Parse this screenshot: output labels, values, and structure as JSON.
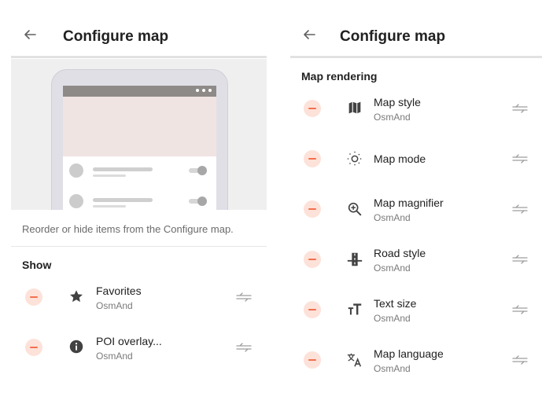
{
  "left": {
    "title": "Configure map",
    "description": "Reorder or hide items from the Configure map.",
    "section": "Show",
    "items": [
      {
        "label": "Favorites",
        "sub": "OsmAnd",
        "icon": "star-icon"
      },
      {
        "label": "POI overlay...",
        "sub": "OsmAnd",
        "icon": "info-icon"
      }
    ]
  },
  "right": {
    "title": "Configure map",
    "section": "Map rendering",
    "items": [
      {
        "label": "Map style",
        "sub": "OsmAnd",
        "icon": "map-icon"
      },
      {
        "label": "Map mode",
        "sub": "",
        "icon": "sun-icon"
      },
      {
        "label": "Map magnifier",
        "sub": "OsmAnd",
        "icon": "zoom-in-icon"
      },
      {
        "label": "Road style",
        "sub": "OsmAnd",
        "icon": "road-icon"
      },
      {
        "label": "Text size",
        "sub": "OsmAnd",
        "icon": "text-size-icon"
      },
      {
        "label": "Map language",
        "sub": "OsmAnd",
        "icon": "translate-icon"
      }
    ]
  },
  "colors": {
    "remove_button_bg": "#fde2d9",
    "remove_button_minus": "#f2704f",
    "icon": "#424242",
    "handle": "#9e9e9e"
  }
}
